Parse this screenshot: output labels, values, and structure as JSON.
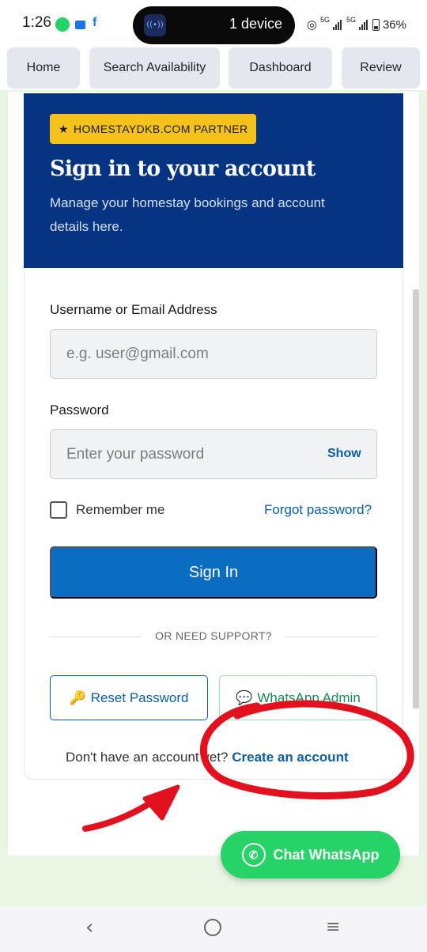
{
  "status_bar": {
    "time": "1:26",
    "device_pill": "1 device",
    "network_1": "5G",
    "network_2": "5G",
    "battery": "36%"
  },
  "nav": {
    "home": "Home",
    "search_availability": "Search Availability",
    "dashboard": "Dashboard",
    "review": "Review"
  },
  "hero": {
    "badge": "HOMESTAYDKB.COM PARTNER",
    "badge_icon": "★",
    "title": "Sign in to your account",
    "subtitle": "Manage your homestay bookings and account details here."
  },
  "form": {
    "username_label": "Username or Email Address",
    "username_placeholder": "e.g. user@gmail.com",
    "password_label": "Password",
    "password_placeholder": "Enter your password",
    "show_label": "Show",
    "remember_label": "Remember me",
    "remember_checked": false,
    "forgot_label": "Forgot password?",
    "signin_label": "Sign In",
    "divider_text": "OR NEED SUPPORT?",
    "reset_icon": "🔑",
    "reset_label": "Reset Password",
    "whatsapp_icon": "💬",
    "whatsapp_label": "WhatsApp Admin",
    "no_account_text": "Don't have an account yet?",
    "create_account_label": "Create an account"
  },
  "chat_whatsapp": {
    "label": "Chat WhatsApp"
  },
  "colors": {
    "hero_bg": "#063483",
    "badge_bg": "#f4c21a",
    "primary_button": "#0a6dc2",
    "link": "#0b5ea8",
    "whatsapp_green": "#25d366",
    "annotation_red": "#e3101e"
  }
}
